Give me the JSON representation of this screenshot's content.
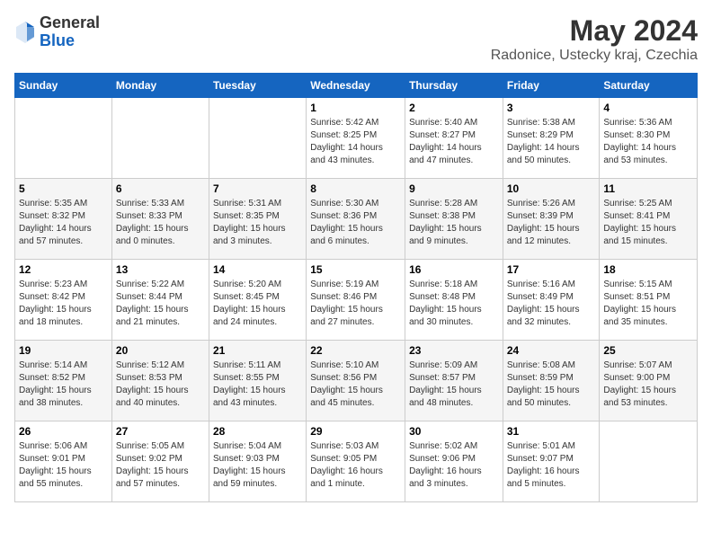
{
  "header": {
    "logo_general": "General",
    "logo_blue": "Blue",
    "month_year": "May 2024",
    "location": "Radonice, Ustecky kraj, Czechia"
  },
  "weekdays": [
    "Sunday",
    "Monday",
    "Tuesday",
    "Wednesday",
    "Thursday",
    "Friday",
    "Saturday"
  ],
  "weeks": [
    [
      {
        "day": "",
        "info": ""
      },
      {
        "day": "",
        "info": ""
      },
      {
        "day": "",
        "info": ""
      },
      {
        "day": "1",
        "info": "Sunrise: 5:42 AM\nSunset: 8:25 PM\nDaylight: 14 hours\nand 43 minutes."
      },
      {
        "day": "2",
        "info": "Sunrise: 5:40 AM\nSunset: 8:27 PM\nDaylight: 14 hours\nand 47 minutes."
      },
      {
        "day": "3",
        "info": "Sunrise: 5:38 AM\nSunset: 8:29 PM\nDaylight: 14 hours\nand 50 minutes."
      },
      {
        "day": "4",
        "info": "Sunrise: 5:36 AM\nSunset: 8:30 PM\nDaylight: 14 hours\nand 53 minutes."
      }
    ],
    [
      {
        "day": "5",
        "info": "Sunrise: 5:35 AM\nSunset: 8:32 PM\nDaylight: 14 hours\nand 57 minutes."
      },
      {
        "day": "6",
        "info": "Sunrise: 5:33 AM\nSunset: 8:33 PM\nDaylight: 15 hours\nand 0 minutes."
      },
      {
        "day": "7",
        "info": "Sunrise: 5:31 AM\nSunset: 8:35 PM\nDaylight: 15 hours\nand 3 minutes."
      },
      {
        "day": "8",
        "info": "Sunrise: 5:30 AM\nSunset: 8:36 PM\nDaylight: 15 hours\nand 6 minutes."
      },
      {
        "day": "9",
        "info": "Sunrise: 5:28 AM\nSunset: 8:38 PM\nDaylight: 15 hours\nand 9 minutes."
      },
      {
        "day": "10",
        "info": "Sunrise: 5:26 AM\nSunset: 8:39 PM\nDaylight: 15 hours\nand 12 minutes."
      },
      {
        "day": "11",
        "info": "Sunrise: 5:25 AM\nSunset: 8:41 PM\nDaylight: 15 hours\nand 15 minutes."
      }
    ],
    [
      {
        "day": "12",
        "info": "Sunrise: 5:23 AM\nSunset: 8:42 PM\nDaylight: 15 hours\nand 18 minutes."
      },
      {
        "day": "13",
        "info": "Sunrise: 5:22 AM\nSunset: 8:44 PM\nDaylight: 15 hours\nand 21 minutes."
      },
      {
        "day": "14",
        "info": "Sunrise: 5:20 AM\nSunset: 8:45 PM\nDaylight: 15 hours\nand 24 minutes."
      },
      {
        "day": "15",
        "info": "Sunrise: 5:19 AM\nSunset: 8:46 PM\nDaylight: 15 hours\nand 27 minutes."
      },
      {
        "day": "16",
        "info": "Sunrise: 5:18 AM\nSunset: 8:48 PM\nDaylight: 15 hours\nand 30 minutes."
      },
      {
        "day": "17",
        "info": "Sunrise: 5:16 AM\nSunset: 8:49 PM\nDaylight: 15 hours\nand 32 minutes."
      },
      {
        "day": "18",
        "info": "Sunrise: 5:15 AM\nSunset: 8:51 PM\nDaylight: 15 hours\nand 35 minutes."
      }
    ],
    [
      {
        "day": "19",
        "info": "Sunrise: 5:14 AM\nSunset: 8:52 PM\nDaylight: 15 hours\nand 38 minutes."
      },
      {
        "day": "20",
        "info": "Sunrise: 5:12 AM\nSunset: 8:53 PM\nDaylight: 15 hours\nand 40 minutes."
      },
      {
        "day": "21",
        "info": "Sunrise: 5:11 AM\nSunset: 8:55 PM\nDaylight: 15 hours\nand 43 minutes."
      },
      {
        "day": "22",
        "info": "Sunrise: 5:10 AM\nSunset: 8:56 PM\nDaylight: 15 hours\nand 45 minutes."
      },
      {
        "day": "23",
        "info": "Sunrise: 5:09 AM\nSunset: 8:57 PM\nDaylight: 15 hours\nand 48 minutes."
      },
      {
        "day": "24",
        "info": "Sunrise: 5:08 AM\nSunset: 8:59 PM\nDaylight: 15 hours\nand 50 minutes."
      },
      {
        "day": "25",
        "info": "Sunrise: 5:07 AM\nSunset: 9:00 PM\nDaylight: 15 hours\nand 53 minutes."
      }
    ],
    [
      {
        "day": "26",
        "info": "Sunrise: 5:06 AM\nSunset: 9:01 PM\nDaylight: 15 hours\nand 55 minutes."
      },
      {
        "day": "27",
        "info": "Sunrise: 5:05 AM\nSunset: 9:02 PM\nDaylight: 15 hours\nand 57 minutes."
      },
      {
        "day": "28",
        "info": "Sunrise: 5:04 AM\nSunset: 9:03 PM\nDaylight: 15 hours\nand 59 minutes."
      },
      {
        "day": "29",
        "info": "Sunrise: 5:03 AM\nSunset: 9:05 PM\nDaylight: 16 hours\nand 1 minute."
      },
      {
        "day": "30",
        "info": "Sunrise: 5:02 AM\nSunset: 9:06 PM\nDaylight: 16 hours\nand 3 minutes."
      },
      {
        "day": "31",
        "info": "Sunrise: 5:01 AM\nSunset: 9:07 PM\nDaylight: 16 hours\nand 5 minutes."
      },
      {
        "day": "",
        "info": ""
      }
    ]
  ]
}
